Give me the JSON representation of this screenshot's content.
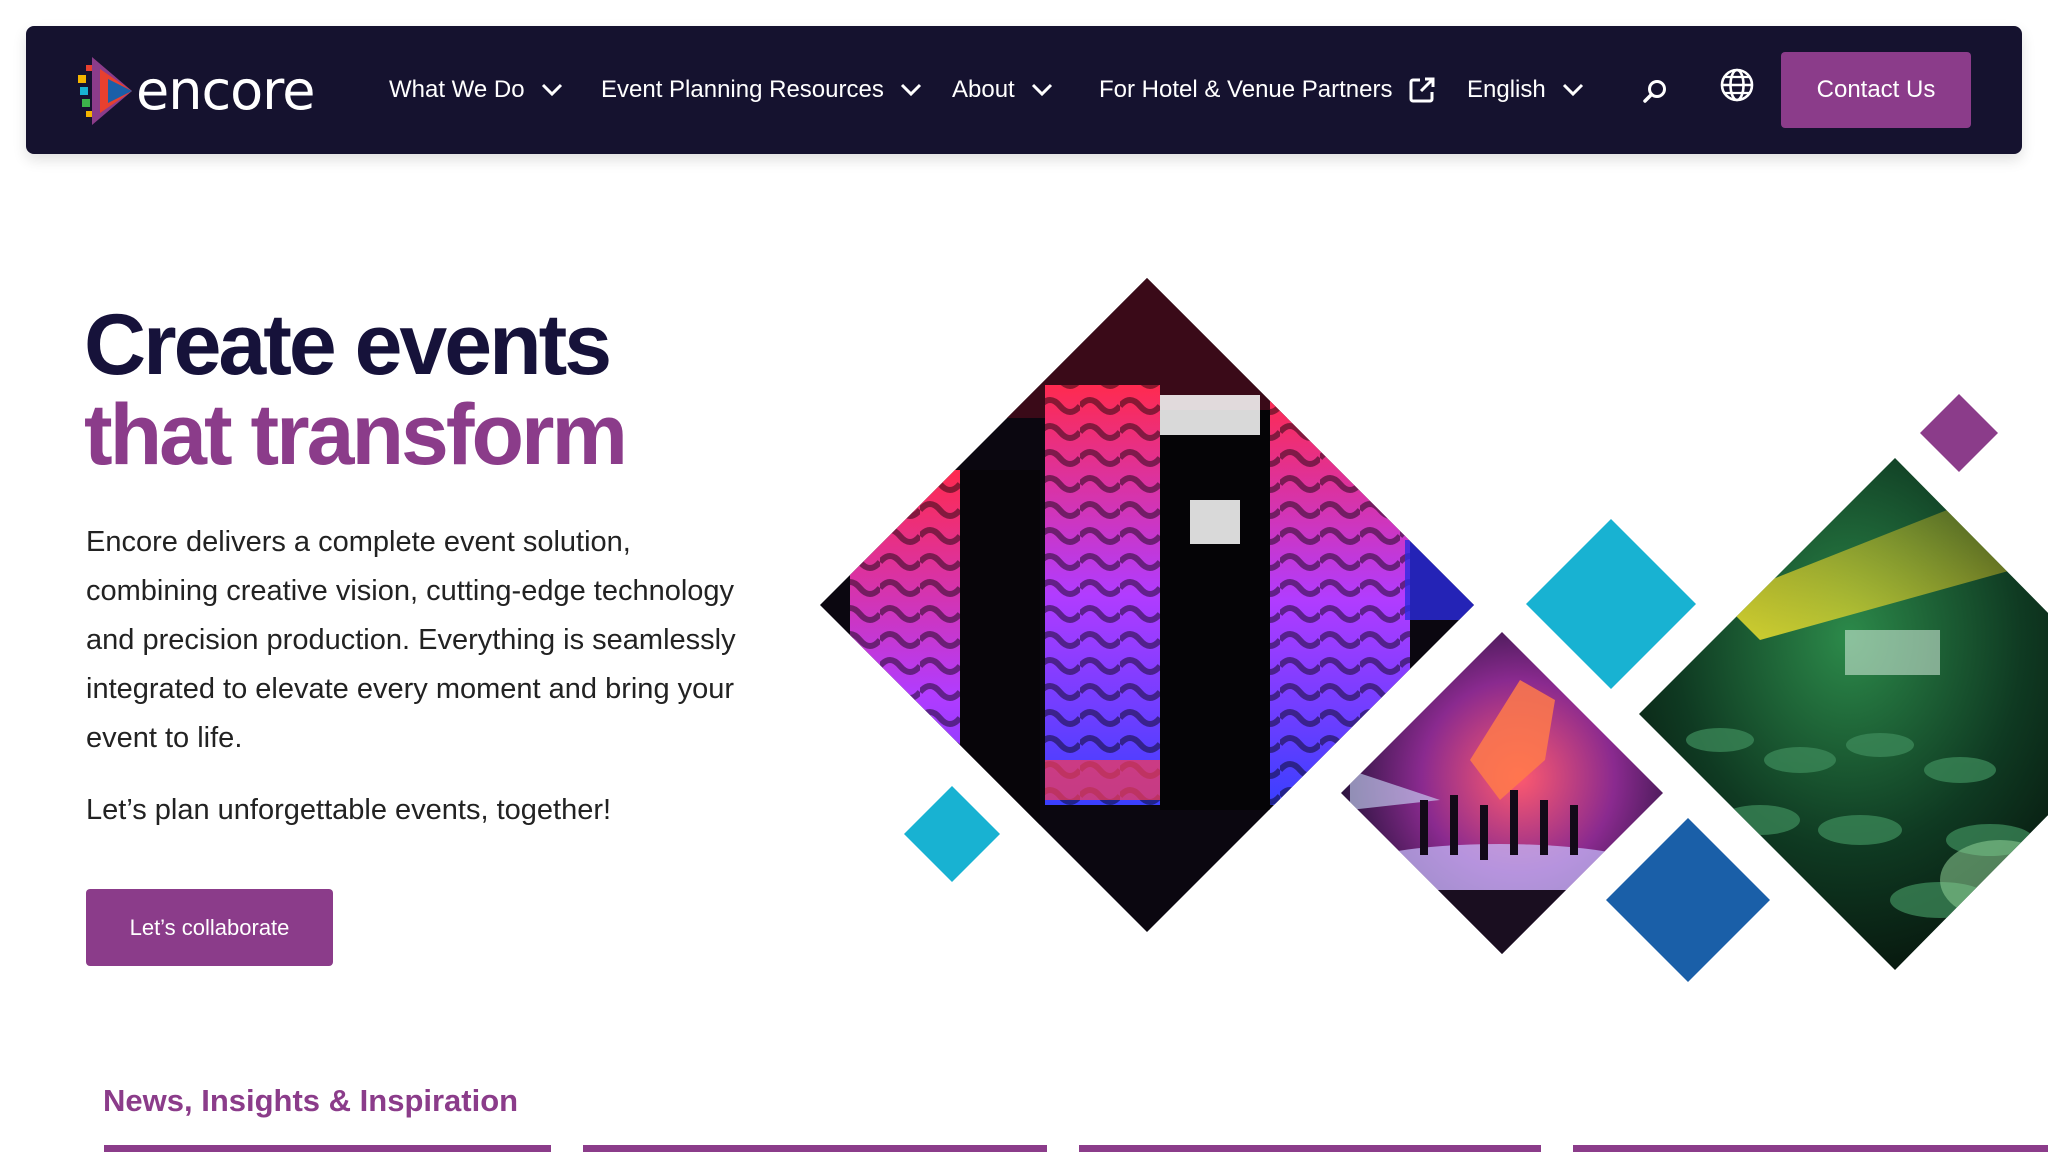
{
  "brand": {
    "name": "encore"
  },
  "nav": {
    "items": [
      {
        "label": "What We Do"
      },
      {
        "label": "Event Planning Resources"
      },
      {
        "label": "About"
      },
      {
        "label": "For Hotel & Venue Partners"
      },
      {
        "label": "English"
      }
    ],
    "contact_label": "Contact Us"
  },
  "hero": {
    "title_line1": "Create events",
    "title_line2": "that transform",
    "description": "Encore delivers a complete event solution, combining creative vision, cutting-edge technology and precision production. Everything is seamlessly integrated to elevate every moment and bring your event to life.",
    "tagline": "Let’s plan unforgettable events, together!",
    "cta_label": "Let’s collaborate"
  },
  "news": {
    "title": "News, Insights & Inspiration"
  },
  "colors": {
    "navy": "#15122f",
    "purple": "#8b3c8a",
    "teal": "#18b2d2",
    "blue": "#1a5fa8"
  },
  "icons": [
    "chevron-down-icon",
    "external-link-icon",
    "search-icon",
    "globe-icon"
  ]
}
